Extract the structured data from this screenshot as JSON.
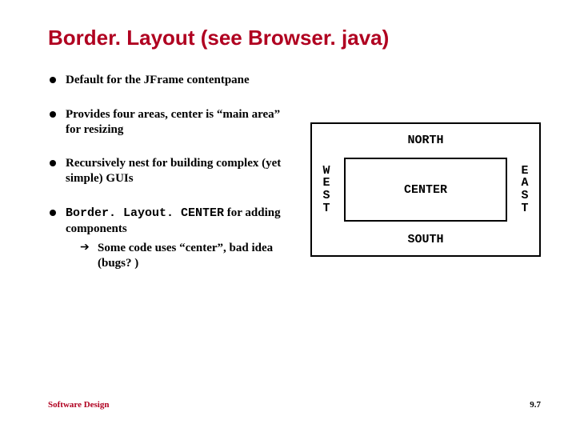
{
  "title": "Border. Layout (see Browser. java)",
  "bullets": {
    "b1": "Default for the JFrame contentpane",
    "b2": "Provides four areas, center is “main area” for resizing",
    "b3": "Recursively nest for building complex (yet simple) GUIs",
    "b4_code": "Border. Layout. CENTER",
    "b4_text": " for adding components",
    "b4_sub": "Some code uses “center”, bad idea (bugs? )"
  },
  "diagram": {
    "north": "NORTH",
    "west": "W\nE\nS\nT",
    "center": "CENTER",
    "east": "E\nA\nS\nT",
    "south": "SOUTH"
  },
  "footer": {
    "left": "Software Design",
    "right": "9.7"
  }
}
